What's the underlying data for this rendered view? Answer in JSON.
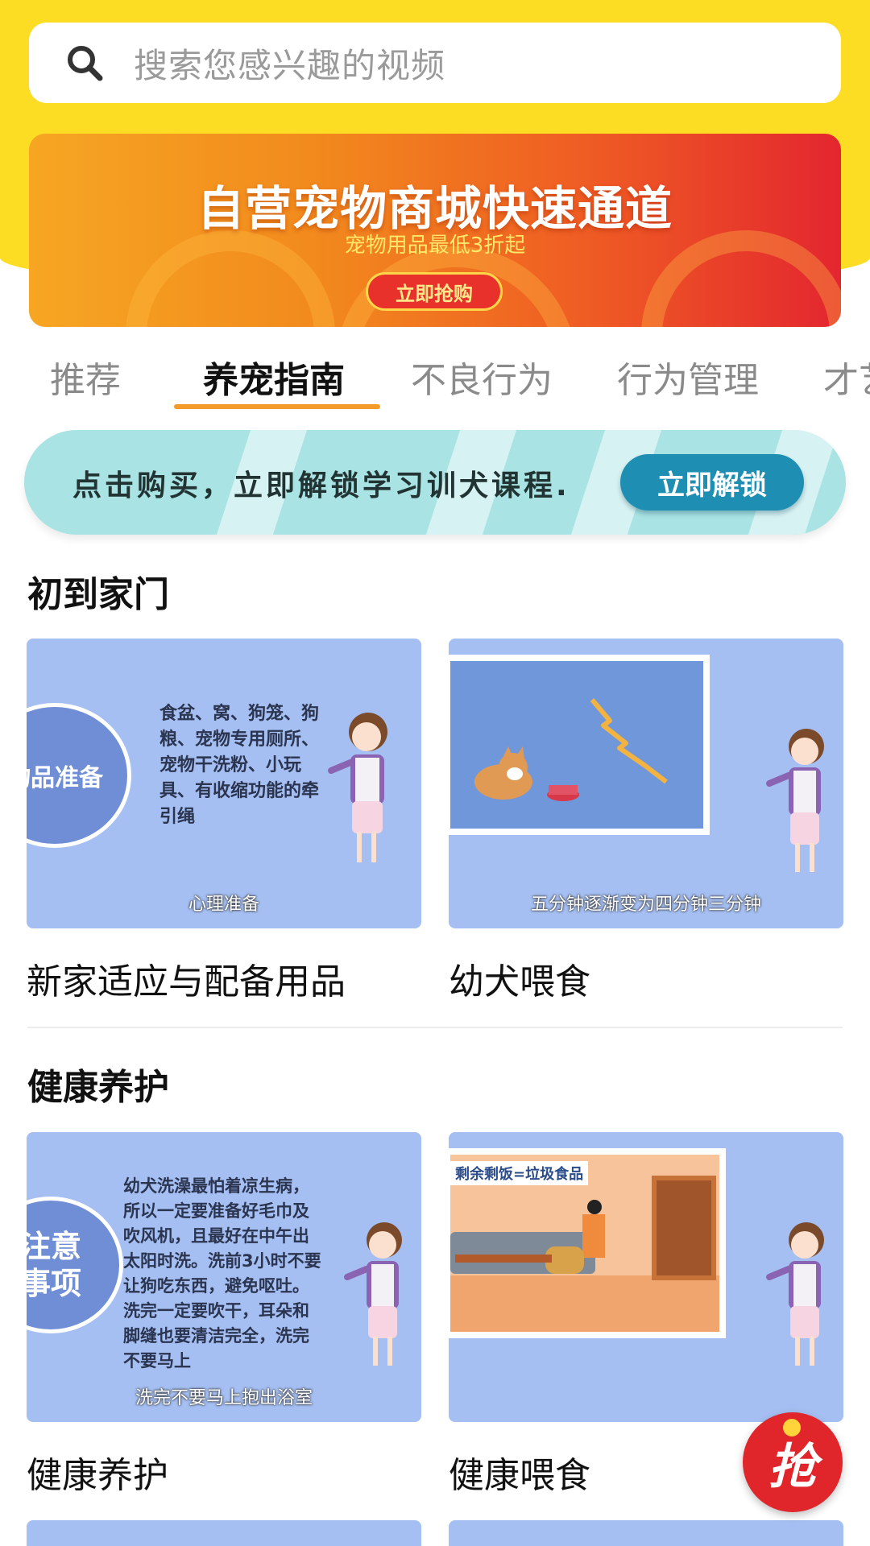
{
  "search": {
    "placeholder": "搜索您感兴趣的视频",
    "icon": "search-icon"
  },
  "banner": {
    "title": "自营宠物商城快速通道",
    "subtitle": "宠物用品最低3折起",
    "button": "立即抢购"
  },
  "tabs": [
    {
      "label": "推荐",
      "active": false
    },
    {
      "label": "养宠指南",
      "active": true
    },
    {
      "label": "不良行为",
      "active": false
    },
    {
      "label": "行为管理",
      "active": false
    },
    {
      "label": "才艺",
      "active": false
    }
  ],
  "unlock": {
    "text": "点击购买，立即解锁学习训犬课程.",
    "button": "立即解锁"
  },
  "sections": [
    {
      "title": "初到家门",
      "cards": [
        {
          "label": "新家适应与配备用品",
          "badge": "物品准备",
          "paragraph": "食盆、窝、狗笼、狗粮、宠物专用厕所、宠物干洗粉、小玩具、有收缩功能的牵引绳",
          "caption": "心理准备"
        },
        {
          "label": "幼犬喂食",
          "caption": "五分钟逐渐变为四分钟三分钟"
        }
      ]
    },
    {
      "title": "健康养护",
      "cards": [
        {
          "label": "健康养护",
          "badge_line1": "注意",
          "badge_line2": "事项",
          "paragraph": "幼犬洗澡最怕着凉生病，所以一定要准备好毛巾及吹风机，且最好在中午出太阳时洗。洗前3小时不要让狗吃东西，避免呕吐。洗完一定要吹干，耳朵和脚缝也要清洁完全，洗完不要马上",
          "caption": "洗完不要马上抱出浴室"
        },
        {
          "label": "健康喂食",
          "sign": "剩余剩饭=垃圾食品"
        }
      ]
    }
  ],
  "fab": {
    "label": "抢"
  }
}
